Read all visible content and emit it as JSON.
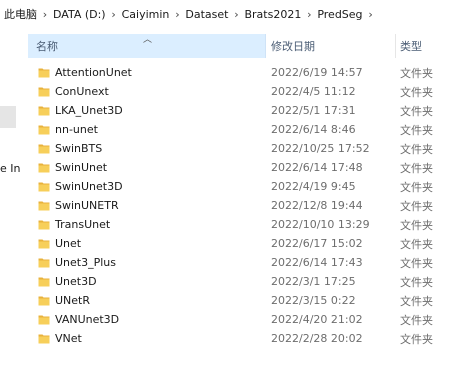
{
  "breadcrumb": [
    "此电脑",
    "DATA (D:)",
    "Caiyimin",
    "Dataset",
    "Brats2021",
    "PredSeg"
  ],
  "left_fragment": "e In",
  "columns": {
    "name": "名称",
    "date": "修改日期",
    "type": "类型"
  },
  "accent_colors": {
    "header_selected": "#dbeeff",
    "folder": "#f5c542"
  },
  "rows": [
    {
      "name": "AttentionUnet",
      "date": "2022/6/19 14:57",
      "type": "文件夹"
    },
    {
      "name": "ConUnext",
      "date": "2022/4/5 11:12",
      "type": "文件夹"
    },
    {
      "name": "LKA_Unet3D",
      "date": "2022/5/1 17:31",
      "type": "文件夹"
    },
    {
      "name": "nn-unet",
      "date": "2022/6/14 8:46",
      "type": "文件夹"
    },
    {
      "name": "SwinBTS",
      "date": "2022/10/25 17:52",
      "type": "文件夹"
    },
    {
      "name": "SwinUnet",
      "date": "2022/6/14 17:48",
      "type": "文件夹"
    },
    {
      "name": "SwinUnet3D",
      "date": "2022/4/19 9:45",
      "type": "文件夹"
    },
    {
      "name": "SwinUNETR",
      "date": "2022/12/8 19:44",
      "type": "文件夹"
    },
    {
      "name": "TransUnet",
      "date": "2022/10/10 13:29",
      "type": "文件夹"
    },
    {
      "name": "Unet",
      "date": "2022/6/17 15:02",
      "type": "文件夹"
    },
    {
      "name": "Unet3_Plus",
      "date": "2022/6/14 17:43",
      "type": "文件夹"
    },
    {
      "name": "Unet3D",
      "date": "2022/3/1 17:25",
      "type": "文件夹"
    },
    {
      "name": "UNetR",
      "date": "2022/3/15 0:22",
      "type": "文件夹"
    },
    {
      "name": "VANUnet3D",
      "date": "2022/4/20 21:02",
      "type": "文件夹"
    },
    {
      "name": "VNet",
      "date": "2022/2/28 20:02",
      "type": "文件夹"
    }
  ]
}
